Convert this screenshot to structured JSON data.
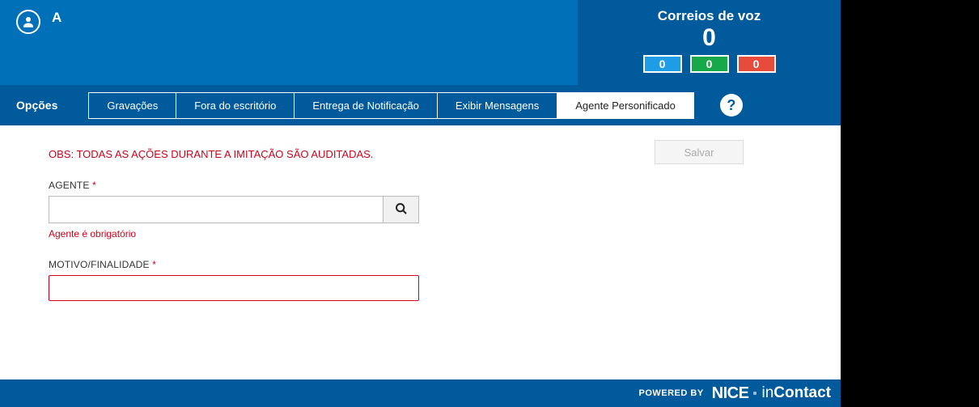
{
  "header": {
    "user_initial": "A",
    "voicemail": {
      "title": "Correios de voz",
      "total": "0",
      "counts": {
        "blue": "0",
        "green": "0",
        "red": "0"
      }
    }
  },
  "tabbar": {
    "opcoes_label": "Opções",
    "tabs": [
      {
        "label": "Gravações",
        "active": false
      },
      {
        "label": "Fora do escritório",
        "active": false
      },
      {
        "label": "Entrega de Notificação",
        "active": false
      },
      {
        "label": "Exibir Mensagens",
        "active": false
      },
      {
        "label": "Agente Personificado",
        "active": true
      }
    ],
    "help": "?"
  },
  "content": {
    "save_label": "Salvar",
    "warning": "OBS: TODAS AS AÇÕES DURANTE A IMITAÇÃO SÃO AUDITADAS.",
    "agent": {
      "label": "AGENTE",
      "req": "*",
      "value": "",
      "error": "Agente é obrigatório"
    },
    "motivo": {
      "label": "MOTIVO/FINALIDADE",
      "req": "*",
      "value": ""
    }
  },
  "footer": {
    "powered": "POWERED BY",
    "brand1": "NICE",
    "brand2a": "in",
    "brand2b": "Contact"
  }
}
